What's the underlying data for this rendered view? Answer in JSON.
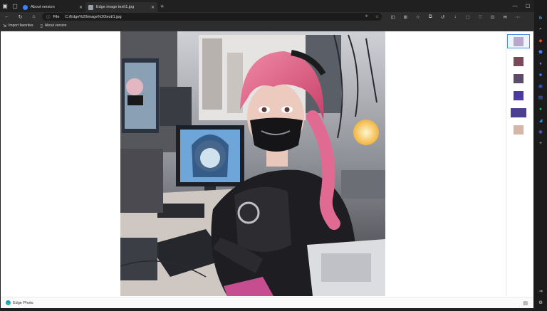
{
  "tabs": [
    {
      "title": "About version",
      "active": false,
      "favicon_color": "#3b82f6"
    },
    {
      "title": "Edge image test\\1.jpg",
      "active": true,
      "favicon_color": "#9aa0a6"
    }
  ],
  "address": {
    "scheme": "File",
    "url": "C:/Edge%20image%20test/1.jpg"
  },
  "favorites": [
    {
      "label": "Import favorites",
      "icon": "import-icon"
    },
    {
      "label": "About version",
      "icon": "page-icon"
    }
  ],
  "thumbnails": [
    {
      "selected": true,
      "color": "#b9a8c9"
    },
    {
      "selected": false,
      "color": "#7a4a59"
    },
    {
      "selected": false,
      "color": "#5b4a68"
    },
    {
      "selected": false,
      "color": "#4c3a9e"
    },
    {
      "selected": false,
      "color": "#4b3f8f"
    },
    {
      "selected": false,
      "color": "#d4b7a6"
    }
  ],
  "status": {
    "label": "Edge Photo"
  },
  "colors": {
    "chrome": "#202020",
    "toolbar": "#2d2d2d",
    "accent": "#4a8fe3"
  }
}
